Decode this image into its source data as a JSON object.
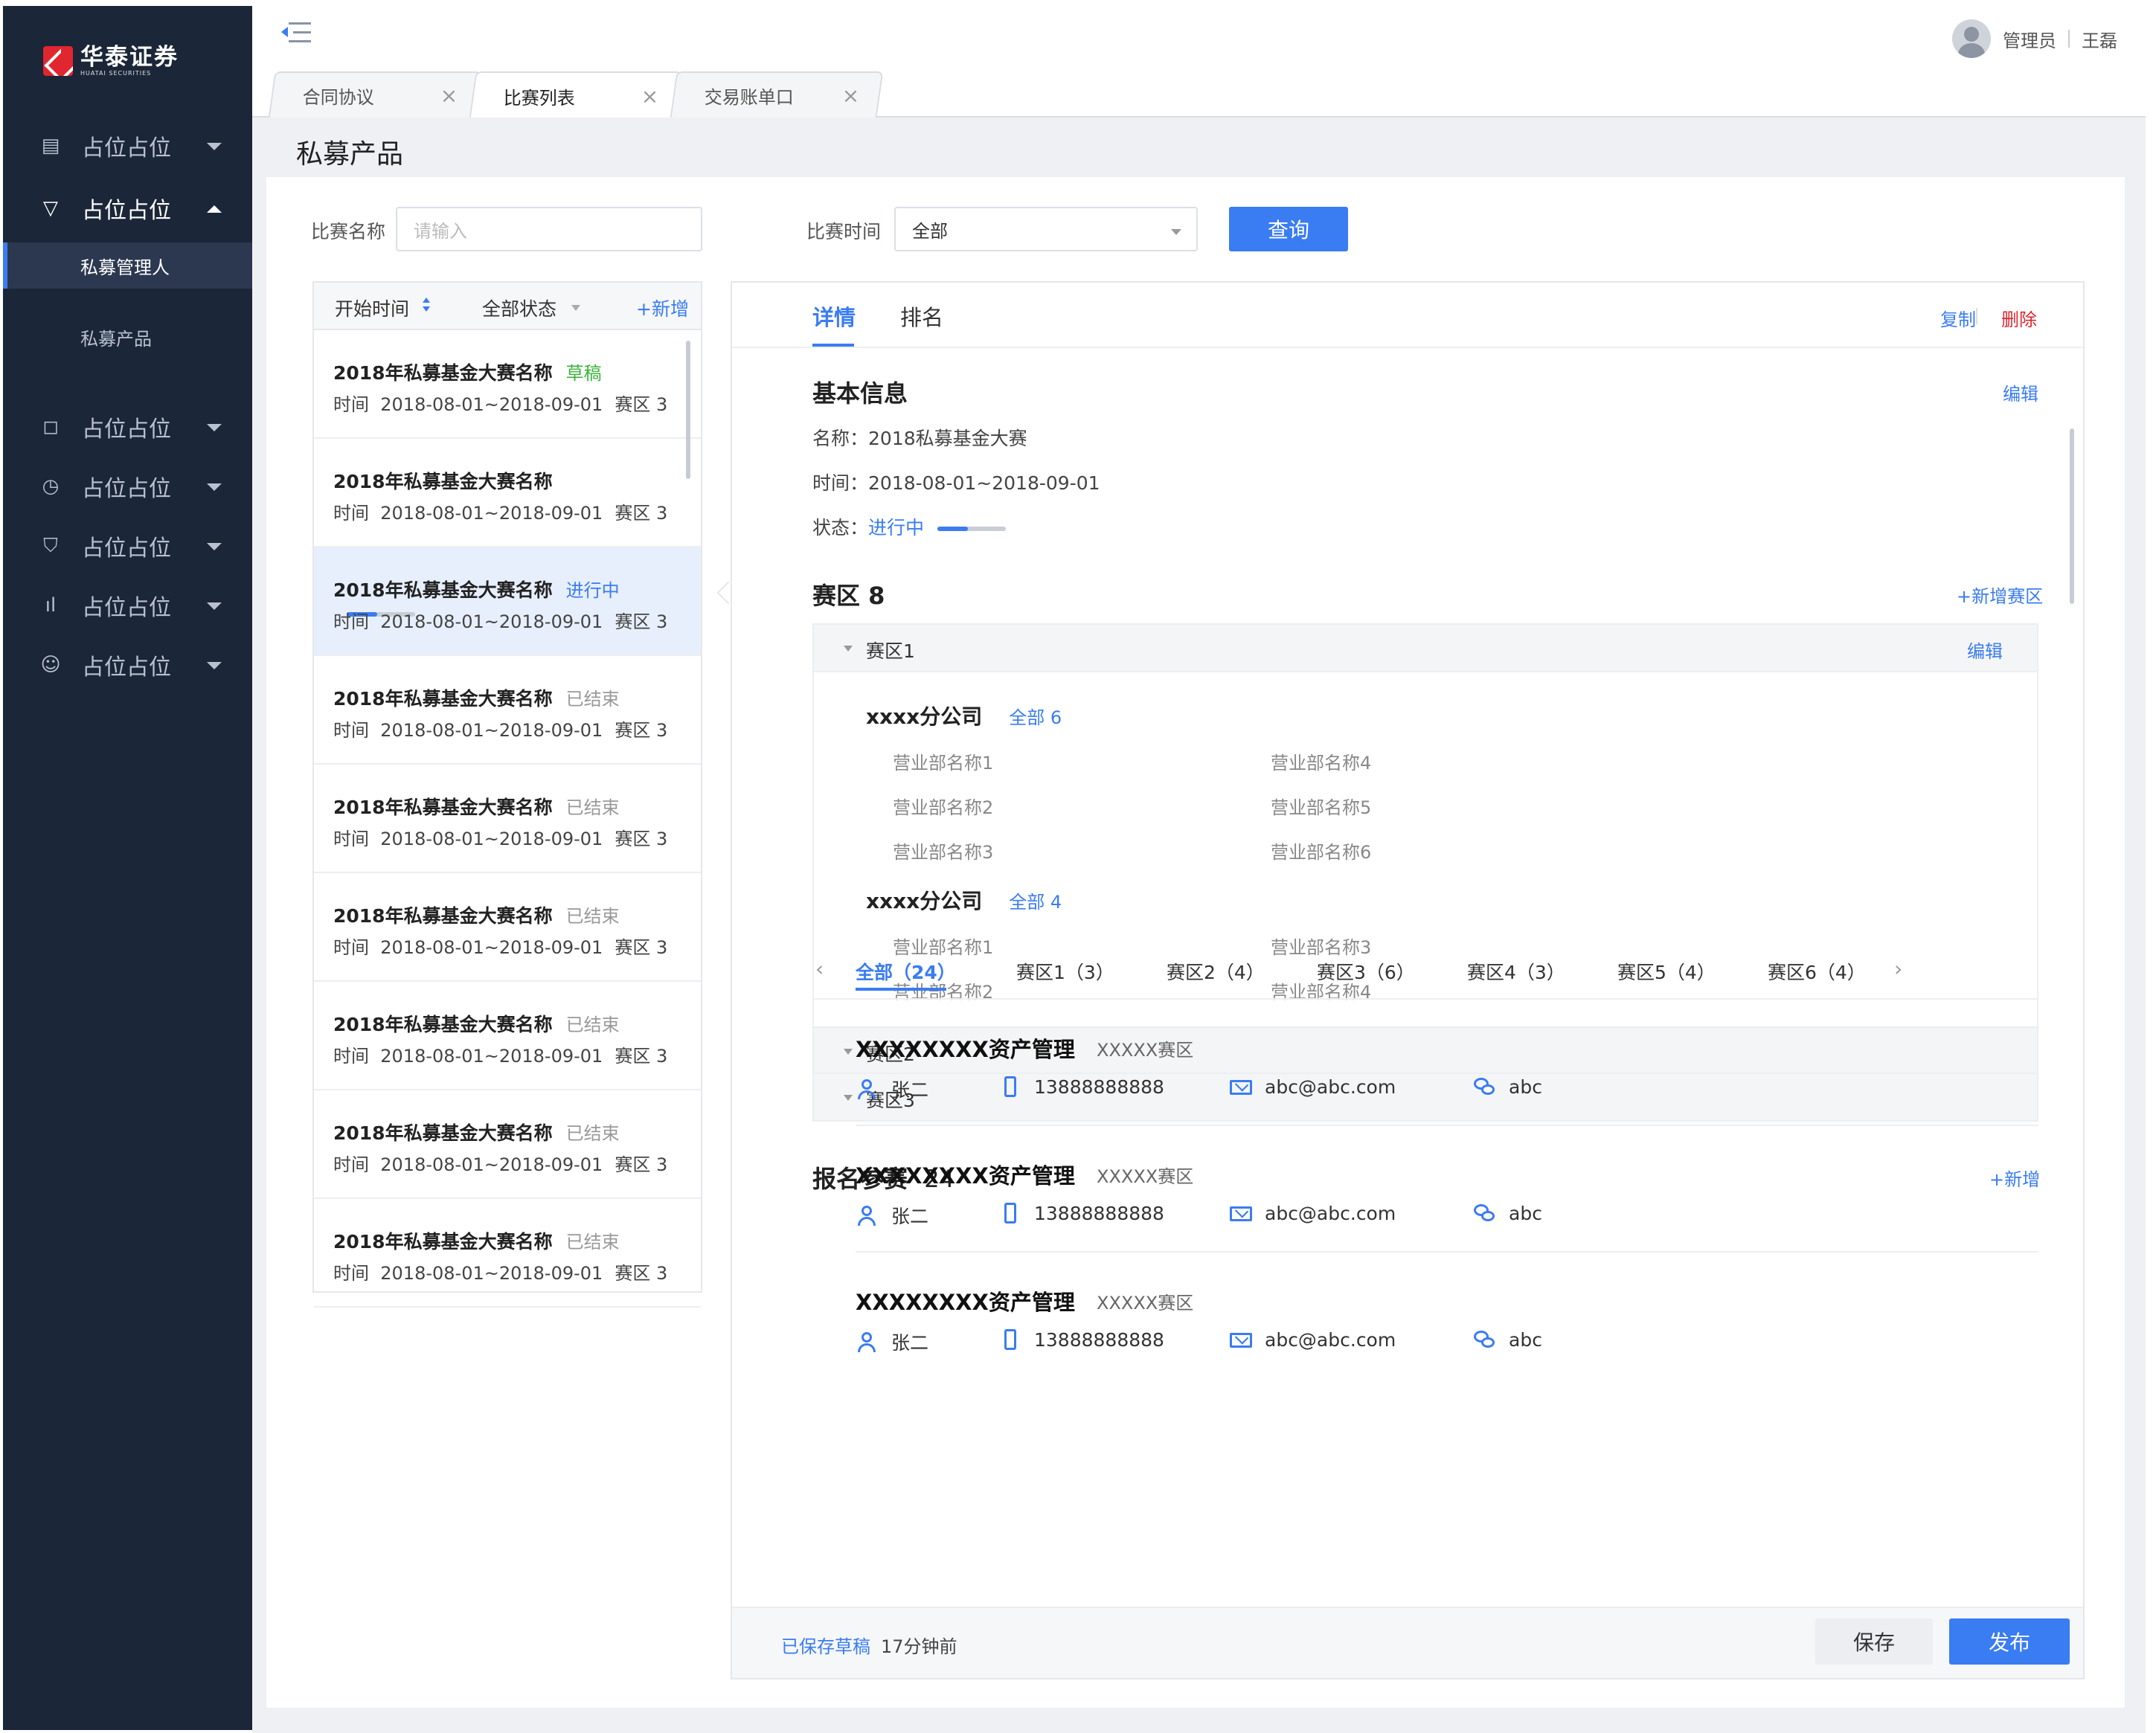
{
  "brand": {
    "name_cn": "华泰证券",
    "name_en": "HUATAI SECURITIES",
    "color": "#e0262e"
  },
  "sidebar": {
    "items": [
      {
        "label": "占位占位",
        "icon": "document-icon",
        "state": "collapsed"
      },
      {
        "label": "占位占位",
        "icon": "filter-icon",
        "state": "expanded"
      },
      {
        "label": "占位占位",
        "icon": "chat-icon",
        "state": "collapsed"
      },
      {
        "label": "占位占位",
        "icon": "clock-icon",
        "state": "collapsed"
      },
      {
        "label": "占位占位",
        "icon": "shield-icon",
        "state": "collapsed"
      },
      {
        "label": "占位占位",
        "icon": "bar-chart-icon",
        "state": "collapsed"
      },
      {
        "label": "占位占位",
        "icon": "user-group-icon",
        "state": "collapsed"
      }
    ],
    "subitems": [
      {
        "label": "私募管理人",
        "active": true
      },
      {
        "label": "私募产品",
        "active": false
      }
    ]
  },
  "header": {
    "role": "管理员",
    "username": "王磊"
  },
  "tabs": [
    {
      "label": "合同协议",
      "active": false
    },
    {
      "label": "比赛列表",
      "active": true
    },
    {
      "label": "交易账单口",
      "active": false
    }
  ],
  "page": {
    "title": "私募产品"
  },
  "filters": {
    "name_label": "比赛名称",
    "name_placeholder": "请输入",
    "time_label": "比赛时间",
    "time_value": "全部",
    "query_button": "查询"
  },
  "list": {
    "header": {
      "start_time": "开始时间",
      "status_filter": "全部状态",
      "add": "+新增"
    },
    "items": [
      {
        "title": "2018年私募基金大赛名称",
        "status": "草稿",
        "status_color": "#3cb33c",
        "time_label": "时间",
        "time": "2018-08-01~2018-09-01",
        "zone": "赛区 3"
      },
      {
        "title": "2018年私募基金大赛名称",
        "status": "",
        "status_color": "#999999",
        "time_label": "时间",
        "time": "2018-08-01~2018-09-01",
        "zone": "赛区 3"
      },
      {
        "title": "2018年私募基金大赛名称",
        "status": "进行中",
        "status_color": "#3a7cf2",
        "time_label": "时间",
        "time": "2018-08-01~2018-09-01",
        "zone": "赛区 3",
        "progress": 0.45
      },
      {
        "title": "2018年私募基金大赛名称",
        "status": "已结束",
        "status_color": "#999999",
        "time_label": "时间",
        "time": "2018-08-01~2018-09-01",
        "zone": "赛区 3"
      },
      {
        "title": "2018年私募基金大赛名称",
        "status": "已结束",
        "status_color": "#999999",
        "time_label": "时间",
        "time": "2018-08-01~2018-09-01",
        "zone": "赛区 3"
      },
      {
        "title": "2018年私募基金大赛名称",
        "status": "已结束",
        "status_color": "#999999",
        "time_label": "时间",
        "time": "2018-08-01~2018-09-01",
        "zone": "赛区 3"
      },
      {
        "title": "2018年私募基金大赛名称",
        "status": "已结束",
        "status_color": "#999999",
        "time_label": "时间",
        "time": "2018-08-01~2018-09-01",
        "zone": "赛区 3"
      },
      {
        "title": "2018年私募基金大赛名称",
        "status": "已结束",
        "status_color": "#999999",
        "time_label": "时间",
        "time": "2018-08-01~2018-09-01",
        "zone": "赛区 3"
      },
      {
        "title": "2018年私募基金大赛名称",
        "status": "已结束",
        "status_color": "#999999",
        "time_label": "时间",
        "time": "2018-08-01~2018-09-01",
        "zone": "赛区 3"
      }
    ]
  },
  "detail": {
    "tabs": [
      {
        "label": "详情",
        "active": true
      },
      {
        "label": "排名",
        "active": false
      }
    ],
    "actions": {
      "copy": "复制",
      "delete": "删除"
    },
    "basic": {
      "title": "基本信息",
      "edit": "编辑",
      "name_line": "名称：2018私募基金大赛",
      "time_line": "时间：2018-08-01~2018-09-01",
      "status_label": "状态：",
      "status_value": "进行中",
      "progress": 0.45
    },
    "regions": {
      "title": "赛区 8",
      "add": "+新增赛区",
      "items": [
        {
          "name": "赛区1",
          "edit": "编辑",
          "expanded": true
        },
        {
          "name": "赛区2",
          "expanded": false
        },
        {
          "name": "赛区3",
          "expanded": false
        }
      ],
      "companies": [
        {
          "name": "xxxx分公司",
          "all": "全部 6",
          "depts": [
            "营业部名称1",
            "营业部名称4",
            "营业部名称2",
            "营业部名称5",
            "营业部名称3",
            "营业部名称6"
          ]
        },
        {
          "name": "xxxx分公司",
          "all": "全部 4",
          "depts": [
            "营业部名称1",
            "营业部名称3",
            "营业部名称2",
            "营业部名称4"
          ]
        }
      ]
    },
    "entrants": {
      "title": "报名参赛",
      "count": "24",
      "add": "+新增",
      "tabs": [
        "全部（24）",
        "赛区1（3）",
        "赛区2（4）",
        "赛区3（6）",
        "赛区4（3）",
        "赛区5（4）",
        "赛区6（4）"
      ],
      "items": [
        {
          "name": "XXXXXXXX资产管理",
          "zone": "XXXXX赛区",
          "contact": "张二",
          "phone": "13888888888",
          "email": "abc@abc.com",
          "wechat": "abc"
        },
        {
          "name": "XXXXXXXX资产管理",
          "zone": "XXXXX赛区",
          "contact": "张二",
          "phone": "13888888888",
          "email": "abc@abc.com",
          "wechat": "abc"
        },
        {
          "name": "XXXXXXXX资产管理",
          "zone": "XXXXX赛区",
          "contact": "张二",
          "phone": "13888888888",
          "email": "abc@abc.com",
          "wechat": "abc"
        }
      ]
    },
    "footer": {
      "saved": "已保存草稿",
      "ago": "17分钟前",
      "save": "保存",
      "publish": "发布"
    }
  },
  "colors": {
    "sidebar_bg": "#1b2638",
    "accent": "#3a7cf2",
    "danger": "#e0262e",
    "draft": "#3cb33c"
  }
}
